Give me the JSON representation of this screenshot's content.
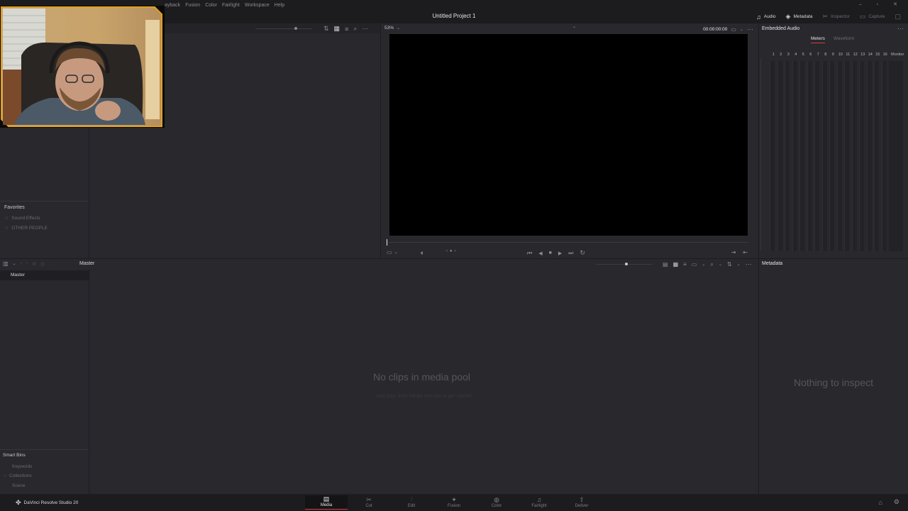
{
  "menu": {
    "items": [
      "ayback",
      "Fusion",
      "Color",
      "Fairlight",
      "Workspace",
      "Help"
    ]
  },
  "window": {
    "title": "Untitled Project 1"
  },
  "header_tabs": {
    "audio": "Audio",
    "metadata": "Metadata",
    "inspector": "Inspector",
    "capture": "Capture"
  },
  "viewer": {
    "zoom": "53%",
    "timecode": "00:00:00:00"
  },
  "audio_panel": {
    "title": "Embedded Audio",
    "tab_meters": "Meters",
    "tab_waveform": "Waveform",
    "channels": [
      "1",
      "2",
      "3",
      "4",
      "5",
      "6",
      "7",
      "8",
      "9",
      "10",
      "11",
      "12",
      "13",
      "14",
      "15",
      "16"
    ],
    "monitor_label": "Monitor"
  },
  "favorites": {
    "title": "Favorites",
    "items": [
      "Sound Effects",
      "OTHER PEOPLE"
    ]
  },
  "media_pool": {
    "bin_label": "Master",
    "tree_item": "Master",
    "empty_title": "No clips in media pool",
    "empty_hint": "Add clips from Media Storage to get started"
  },
  "smart_bins": {
    "title": "Smart Bins",
    "items": [
      "Keywords",
      "Collections",
      "Scene"
    ]
  },
  "metadata_panel": {
    "title": "Metadata",
    "empty": "Nothing to inspect"
  },
  "footer": {
    "app_name": "DaVinci Resolve Studio 20",
    "pages": [
      "Media",
      "Cut",
      "Edit",
      "Fusion",
      "Color",
      "Fairlight",
      "Deliver"
    ],
    "active_page": "Media"
  },
  "colors": {
    "accent_red": "#d0403a",
    "webcam_border": "#e0a020"
  }
}
